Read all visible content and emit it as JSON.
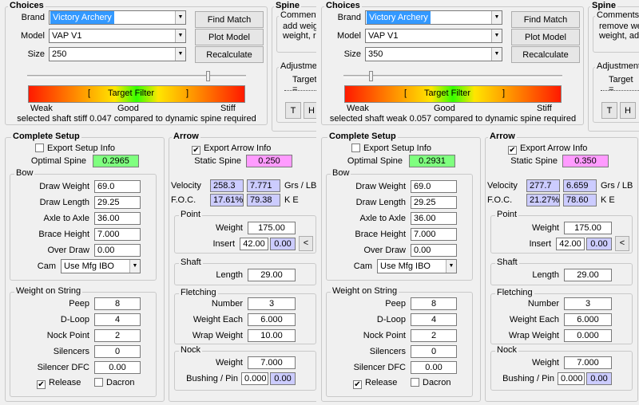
{
  "labels": {
    "choices": "Choices",
    "brand": "Brand",
    "model": "Model",
    "size": "Size",
    "find_match": "Find Match",
    "plot_model": "Plot Model",
    "recalculate": "Recalculate",
    "spine": "Spine",
    "comments": "Comments",
    "adjustments": "Adjustments",
    "target_eq": "Target =",
    "t_button": "T",
    "h_button": "H",
    "target_filter": "Target Filter",
    "bracket_open": "[",
    "bracket_close": "]",
    "weak": "Weak",
    "good": "Good",
    "stiff": "Stiff",
    "complete_setup": "Complete Setup",
    "export_setup_info": "Export Setup Info",
    "optimal_spine": "Optimal Spine",
    "bow": "Bow",
    "draw_weight": "Draw Weight",
    "draw_length": "Draw Length",
    "axle_to_axle": "Axle to Axle",
    "brace_height": "Brace Height",
    "over_draw": "Over Draw",
    "cam": "Cam",
    "weight_on_string": "Weight on String",
    "peep": "Peep",
    "d_loop": "D-Loop",
    "nock_point": "Nock Point",
    "silencers": "Silencers",
    "silencer_dfc": "Silencer DFC",
    "release": "Release",
    "dacron": "Dacron",
    "arrow": "Arrow",
    "export_arrow_info": "Export Arrow Info",
    "static_spine": "Static Spine",
    "velocity": "Velocity",
    "grs_lb": "Grs / LB",
    "foc": "F.O.C.",
    "ke": "K E",
    "point": "Point",
    "weight": "Weight",
    "insert": "Insert",
    "lt_button": "<",
    "shaft": "Shaft",
    "length": "Length",
    "fletching": "Fletching",
    "number": "Number",
    "weight_each": "Weight Each",
    "wrap_weight": "Wrap Weight",
    "nock": "Nock",
    "bushing_pin": "Bushing / Pin"
  },
  "left": {
    "brand": "Victory Archery",
    "model": "VAP V1",
    "size": "250",
    "comments_text": "add weig\nweight, re",
    "status": "selected shaft stiff 0.047 compared to dynamic spine required",
    "export_setup_checked": false,
    "optimal_spine": "0.2965",
    "draw_weight": "69.0",
    "draw_length": "29.25",
    "axle_to_axle": "36.00",
    "brace_height": "7.000",
    "over_draw": "0.00",
    "cam": "Use Mfg IBO",
    "peep": "8",
    "d_loop": "4",
    "nock_point": "2",
    "silencers": "0",
    "silencer_dfc": "0.00",
    "release_checked": true,
    "dacron_checked": false,
    "export_arrow_checked": true,
    "static_spine": "0.250",
    "velocity": "258.3",
    "grs_lb": "7.771",
    "foc": "17.61%",
    "ke": "79.38",
    "point_weight": "175.00",
    "insert_1": "42.00",
    "insert_2": "0.00",
    "shaft_length": "29.00",
    "fletch_number": "3",
    "fletch_weight_each": "6.000",
    "wrap_weight": "10.00",
    "nock_weight": "7.000",
    "bushing_1": "0.000",
    "bushing_2": "0.00"
  },
  "right": {
    "brand": "Victory Archery",
    "model": "VAP V1",
    "size": "350",
    "comments_text": "remove we\nweight, add",
    "status": "selected shaft weak 0.057 compared to dynamic spine required",
    "export_setup_checked": false,
    "optimal_spine": "0.2931",
    "draw_weight": "69.0",
    "draw_length": "29.25",
    "axle_to_axle": "36.00",
    "brace_height": "7.000",
    "over_draw": "0.00",
    "cam": "Use Mfg IBO",
    "peep": "8",
    "d_loop": "4",
    "nock_point": "2",
    "silencers": "0",
    "silencer_dfc": "0.00",
    "release_checked": true,
    "dacron_checked": false,
    "export_arrow_checked": true,
    "static_spine": "0.350",
    "velocity": "277.7",
    "grs_lb": "6.659",
    "foc": "21.27%",
    "ke": "78.60",
    "point_weight": "175.00",
    "insert_1": "42.00",
    "insert_2": "0.00",
    "shaft_length": "29.00",
    "fletch_number": "3",
    "fletch_weight_each": "6.000",
    "wrap_weight": "0.000",
    "nock_weight": "7.000",
    "bushing_1": "0.000",
    "bushing_2": "0.00"
  }
}
